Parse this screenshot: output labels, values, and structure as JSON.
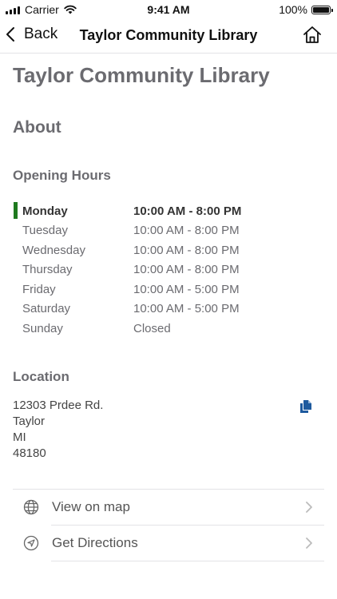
{
  "status_bar": {
    "carrier": "Carrier",
    "time": "9:41 AM",
    "battery": "100%"
  },
  "nav": {
    "back_label": "Back",
    "title": "Taylor Community Library",
    "home_icon": "home-icon"
  },
  "page": {
    "title": "Taylor Community Library",
    "about_heading": "About"
  },
  "hours": {
    "heading": "Opening Hours",
    "rows": [
      {
        "day": "Monday",
        "time": "10:00 AM - 8:00 PM"
      },
      {
        "day": "Tuesday",
        "time": "10:00 AM - 8:00 PM"
      },
      {
        "day": "Wednesday",
        "time": "10:00 AM - 8:00 PM"
      },
      {
        "day": "Thursday",
        "time": "10:00 AM - 8:00 PM"
      },
      {
        "day": "Friday",
        "time": "10:00 AM - 5:00 PM"
      },
      {
        "day": "Saturday",
        "time": "10:00 AM - 5:00 PM"
      },
      {
        "day": "Sunday",
        "time": "Closed"
      }
    ]
  },
  "location": {
    "heading": "Location",
    "address_lines": [
      "12303 Prdee Rd.",
      "Taylor",
      "MI",
      "48180"
    ]
  },
  "links": [
    {
      "label": "View on map",
      "icon": "globe-icon"
    },
    {
      "label": "Get Directions",
      "icon": "navigation-arrow-icon"
    }
  ],
  "colors": {
    "today_marker": "#1f7a1f",
    "copy_icon": "#1e5a9e",
    "heading_gray": "#6b6b70"
  }
}
